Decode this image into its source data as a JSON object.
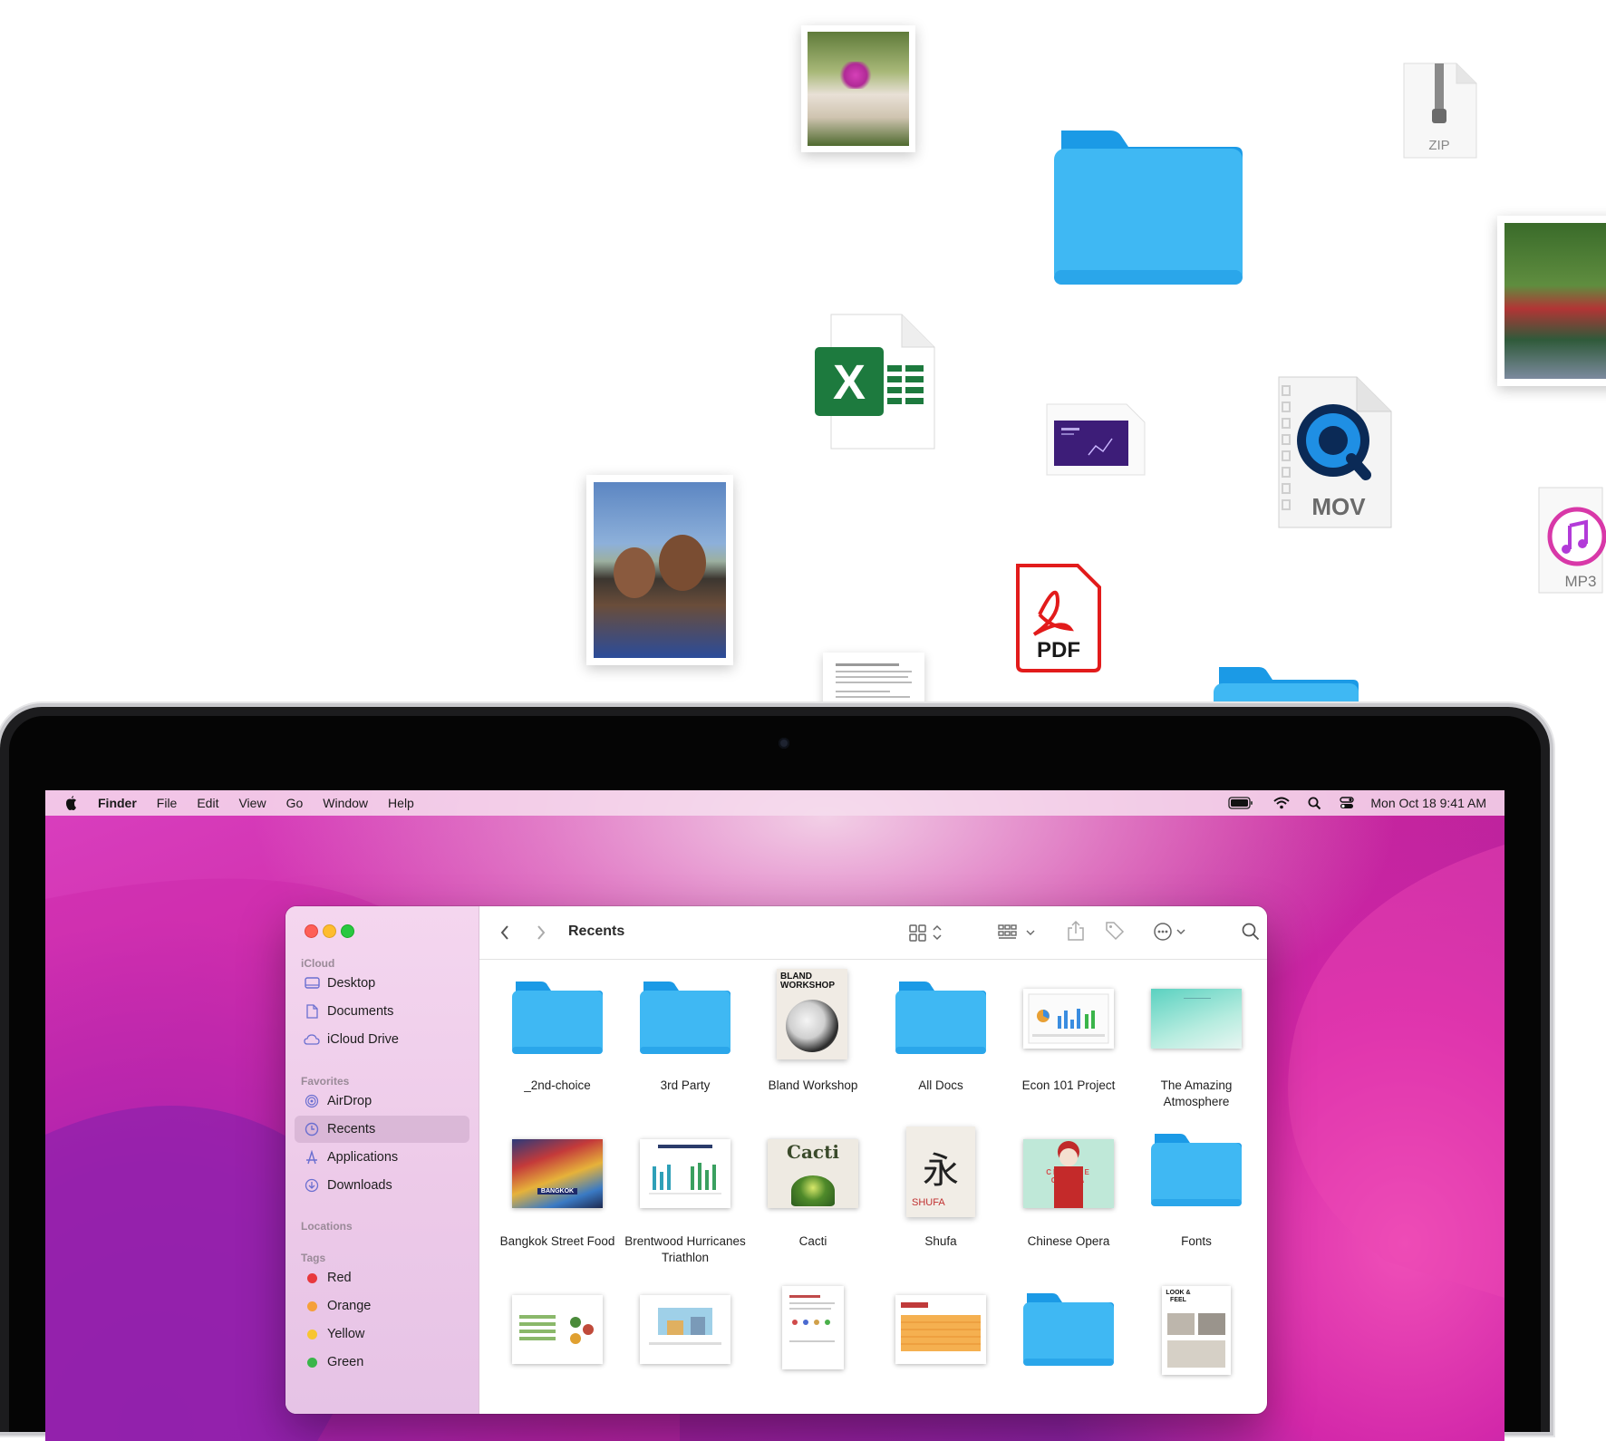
{
  "floating_files": {
    "zip_label": "ZIP",
    "mov_label": "MOV",
    "mp3_label": "MP3",
    "pdf_label": "PDF",
    "excel_letter": "X",
    "icons": [
      "photo-icon",
      "folder-icon",
      "zip-icon",
      "excel-icon",
      "keynote-icon",
      "quicktime-mov-icon",
      "music-mp3-icon",
      "pdf-icon",
      "document-icon"
    ]
  },
  "menubar": {
    "apple": "",
    "app_name": "Finder",
    "menus": [
      "File",
      "Edit",
      "View",
      "Go",
      "Window",
      "Help"
    ],
    "clock": "Mon Oct 18  9:41 AM"
  },
  "finder": {
    "title": "Recents",
    "sidebar": {
      "sections": {
        "icloud": "iCloud",
        "favorites": "Favorites",
        "locations": "Locations",
        "tags": "Tags"
      },
      "icloud_items": [
        "Desktop",
        "Documents",
        "iCloud Drive"
      ],
      "favorite_items": [
        "AirDrop",
        "Recents",
        "Applications",
        "Downloads"
      ],
      "selected": "Recents",
      "tags": [
        {
          "label": "Red",
          "color": "#e8383d"
        },
        {
          "label": "Orange",
          "color": "#f5a03a"
        },
        {
          "label": "Yellow",
          "color": "#f7c531"
        },
        {
          "label": "Green",
          "color": "#3ab54a"
        }
      ]
    },
    "items": [
      {
        "label": "_2nd-choice",
        "kind": "folder"
      },
      {
        "label": "3rd Party",
        "kind": "folder"
      },
      {
        "label": "Bland Workshop",
        "kind": "book",
        "cover_text": "BLAND WORKSHOP"
      },
      {
        "label": "All Docs",
        "kind": "folder"
      },
      {
        "label": "Econ 101 Project",
        "kind": "spreadsheet"
      },
      {
        "label": "The Amazing Atmosphere",
        "kind": "keynote"
      },
      {
        "label": "Bangkok Street Food",
        "kind": "photo-doc",
        "cover_text": "BANGKOK"
      },
      {
        "label": "Brentwood Hurricanes Triathlon",
        "kind": "chart-doc"
      },
      {
        "label": "Cacti",
        "kind": "book",
        "cover_text": "Cacti"
      },
      {
        "label": "Shufa",
        "kind": "book",
        "cover_text": "SHUFA",
        "glyph": "永"
      },
      {
        "label": "Chinese Opera",
        "kind": "poster",
        "cover_text": "CHINESE OPERA"
      },
      {
        "label": "Fonts",
        "kind": "folder"
      },
      {
        "label": "",
        "kind": "spreadsheet"
      },
      {
        "label": "",
        "kind": "chart-doc"
      },
      {
        "label": "",
        "kind": "document"
      },
      {
        "label": "",
        "kind": "spreadsheet"
      },
      {
        "label": "",
        "kind": "folder"
      },
      {
        "label": "",
        "kind": "document",
        "cover_text": "LOOK & FEEL"
      }
    ]
  },
  "colors": {
    "folder_blue": "#3fb8f3",
    "folder_tab": "#1b9ae6",
    "pdf_red": "#e21b1b",
    "excel_green": "#1d7a3e",
    "accent_pink": "#d52fb6"
  }
}
